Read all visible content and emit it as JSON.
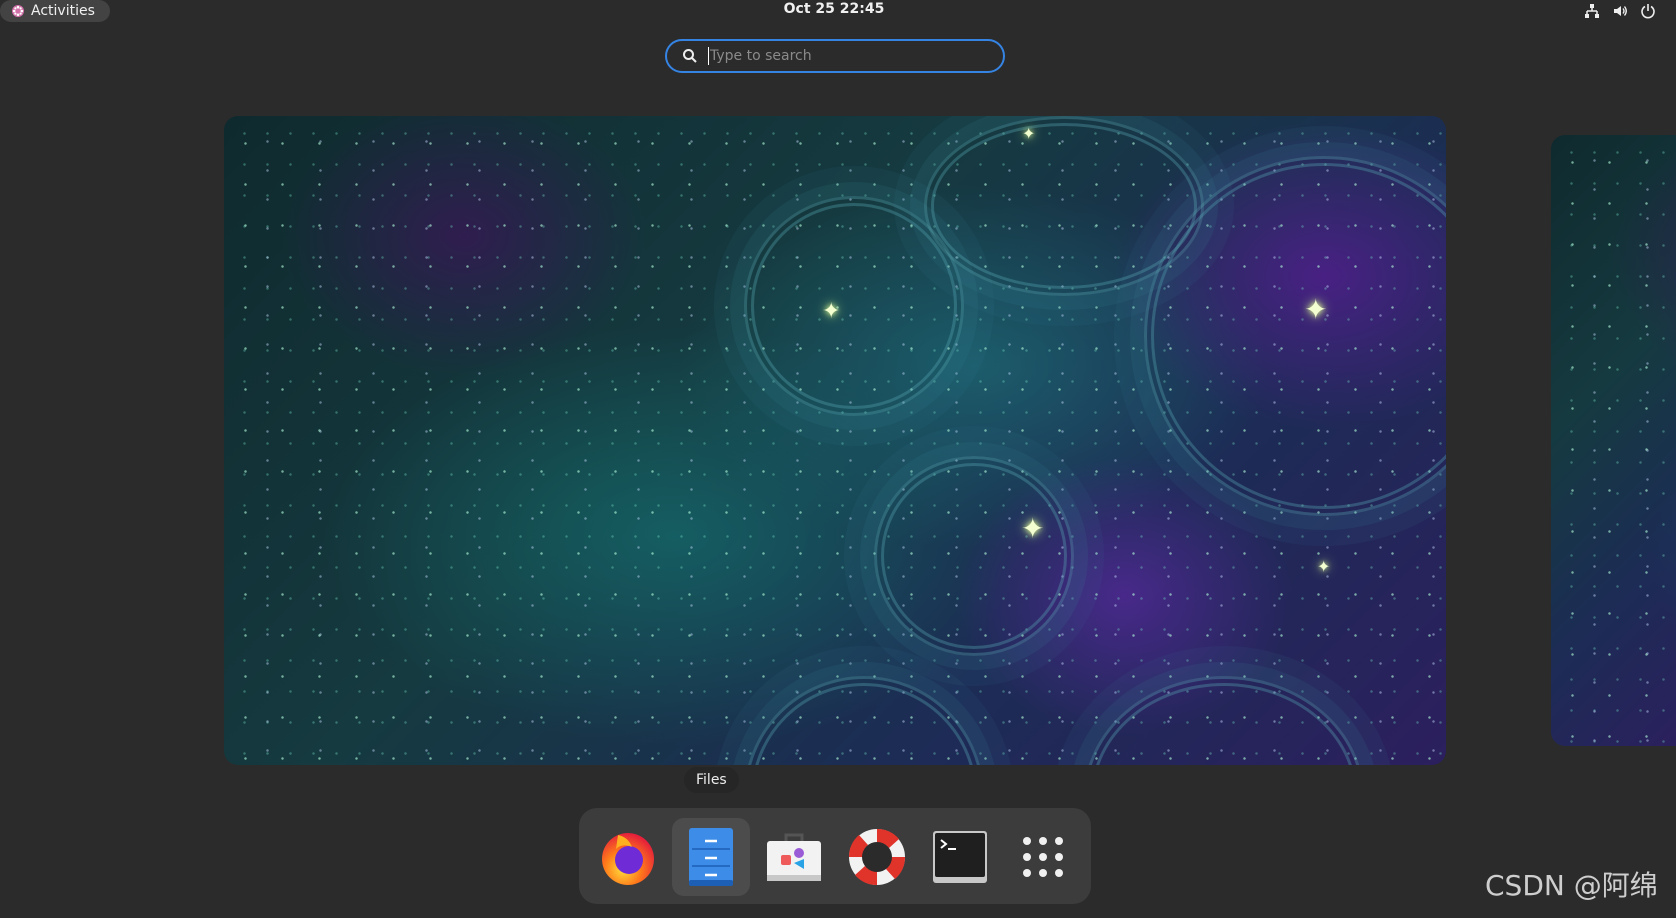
{
  "topbar": {
    "activities_label": "Activities",
    "clock": "Oct 25  22:45",
    "tray": [
      "network-icon",
      "volume-icon",
      "power-icon"
    ]
  },
  "search": {
    "placeholder": "Type to search",
    "value": ""
  },
  "dash": {
    "tooltip": "Files",
    "items": [
      {
        "name": "Firefox",
        "icon": "firefox-icon"
      },
      {
        "name": "Files",
        "icon": "files-icon",
        "active": true
      },
      {
        "name": "Software",
        "icon": "software-icon"
      },
      {
        "name": "Help",
        "icon": "help-icon"
      },
      {
        "name": "Terminal",
        "icon": "terminal-icon"
      },
      {
        "name": "Show Applications",
        "icon": "app-grid-icon"
      }
    ]
  },
  "watermark": "CSDN @阿绵",
  "colors": {
    "accent": "#3584e4",
    "panel": "#2b2b2b",
    "dash": "#3c3c3c"
  }
}
